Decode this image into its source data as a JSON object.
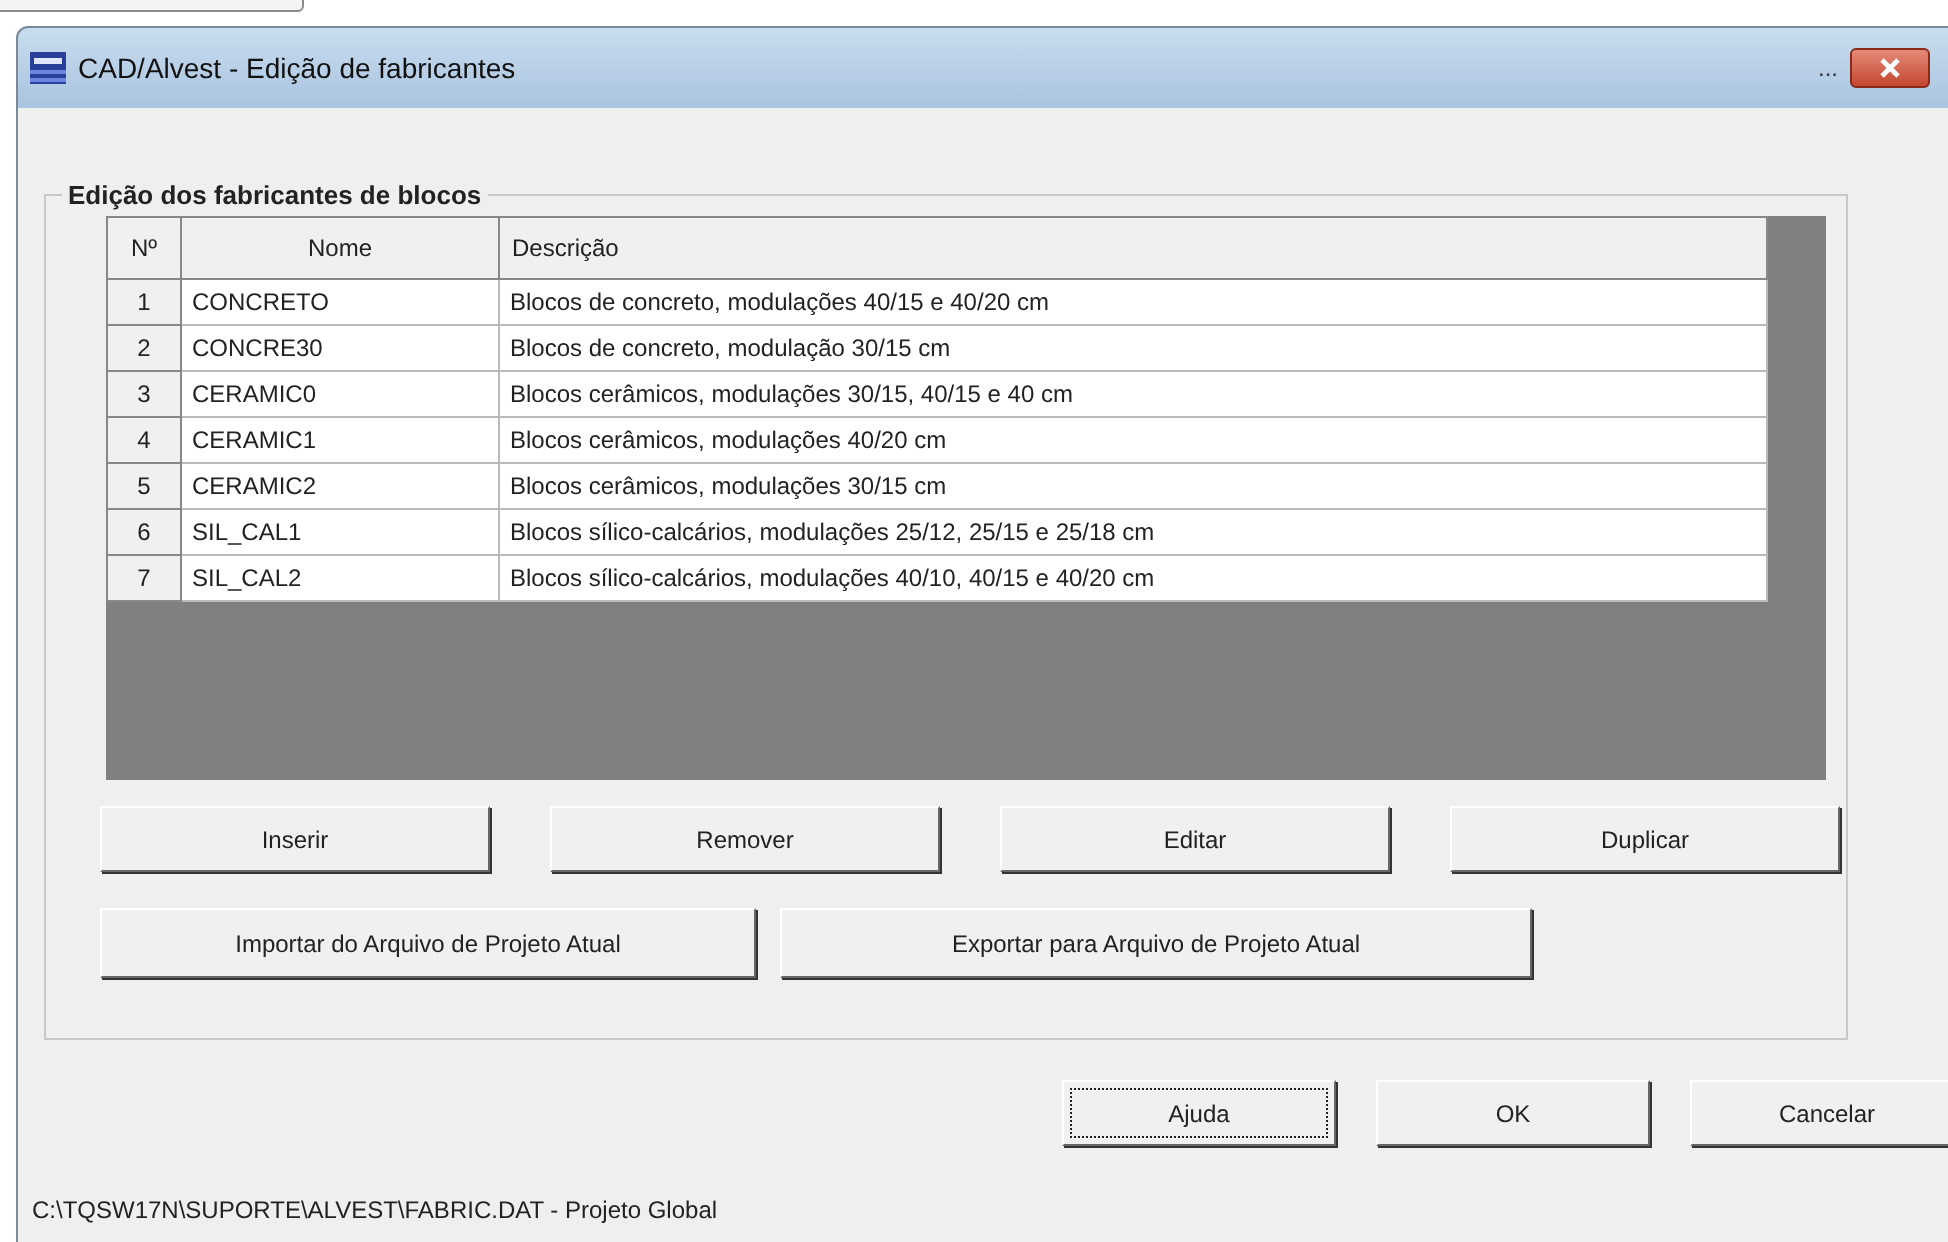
{
  "window": {
    "title": "CAD/Alvest - Edição de fabricantes",
    "title_extra": "..."
  },
  "group": {
    "title": "Edição dos fabricantes de blocos"
  },
  "table": {
    "columns": [
      "Nº",
      "Nome",
      "Descrição"
    ],
    "rows": [
      {
        "cells": [
          "1",
          "CONCRETO",
          "Blocos de concreto, modulações 40/15 e 40/20 cm"
        ]
      },
      {
        "cells": [
          "2",
          "CONCRE30",
          "Blocos de concreto, modulação 30/15 cm"
        ]
      },
      {
        "cells": [
          "3",
          "CERAMIC0",
          "Blocos cerâmicos, modulações 30/15, 40/15 e 40 cm"
        ]
      },
      {
        "cells": [
          "4",
          "CERAMIC1",
          "Blocos cerâmicos, modulações 40/20 cm"
        ]
      },
      {
        "cells": [
          "5",
          "CERAMIC2",
          "Blocos cerâmicos, modulações 30/15 cm"
        ]
      },
      {
        "cells": [
          "6",
          "SIL_CAL1",
          "Blocos sílico-calcários, modulações 25/12, 25/15 e 25/18 cm"
        ]
      },
      {
        "cells": [
          "7",
          "SIL_CAL2",
          "Blocos sílico-calcários, modulações 40/10, 40/15 e 40/20 cm"
        ]
      }
    ]
  },
  "edit_buttons": [
    "Inserir",
    "Remover",
    "Editar",
    "Duplicar"
  ],
  "file_buttons": [
    "Importar do Arquivo de Projeto Atual",
    "Exportar para Arquivo de Projeto Atual"
  ],
  "dialog_buttons": [
    {
      "label": "Ajuda",
      "focused": true
    },
    {
      "label": "OK",
      "focused": false
    },
    {
      "label": "Cancelar",
      "focused": false
    }
  ],
  "status_bar": "C:\\TQSW17N\\SUPORTE\\ALVEST\\FABRIC.DAT - Projeto Global"
}
